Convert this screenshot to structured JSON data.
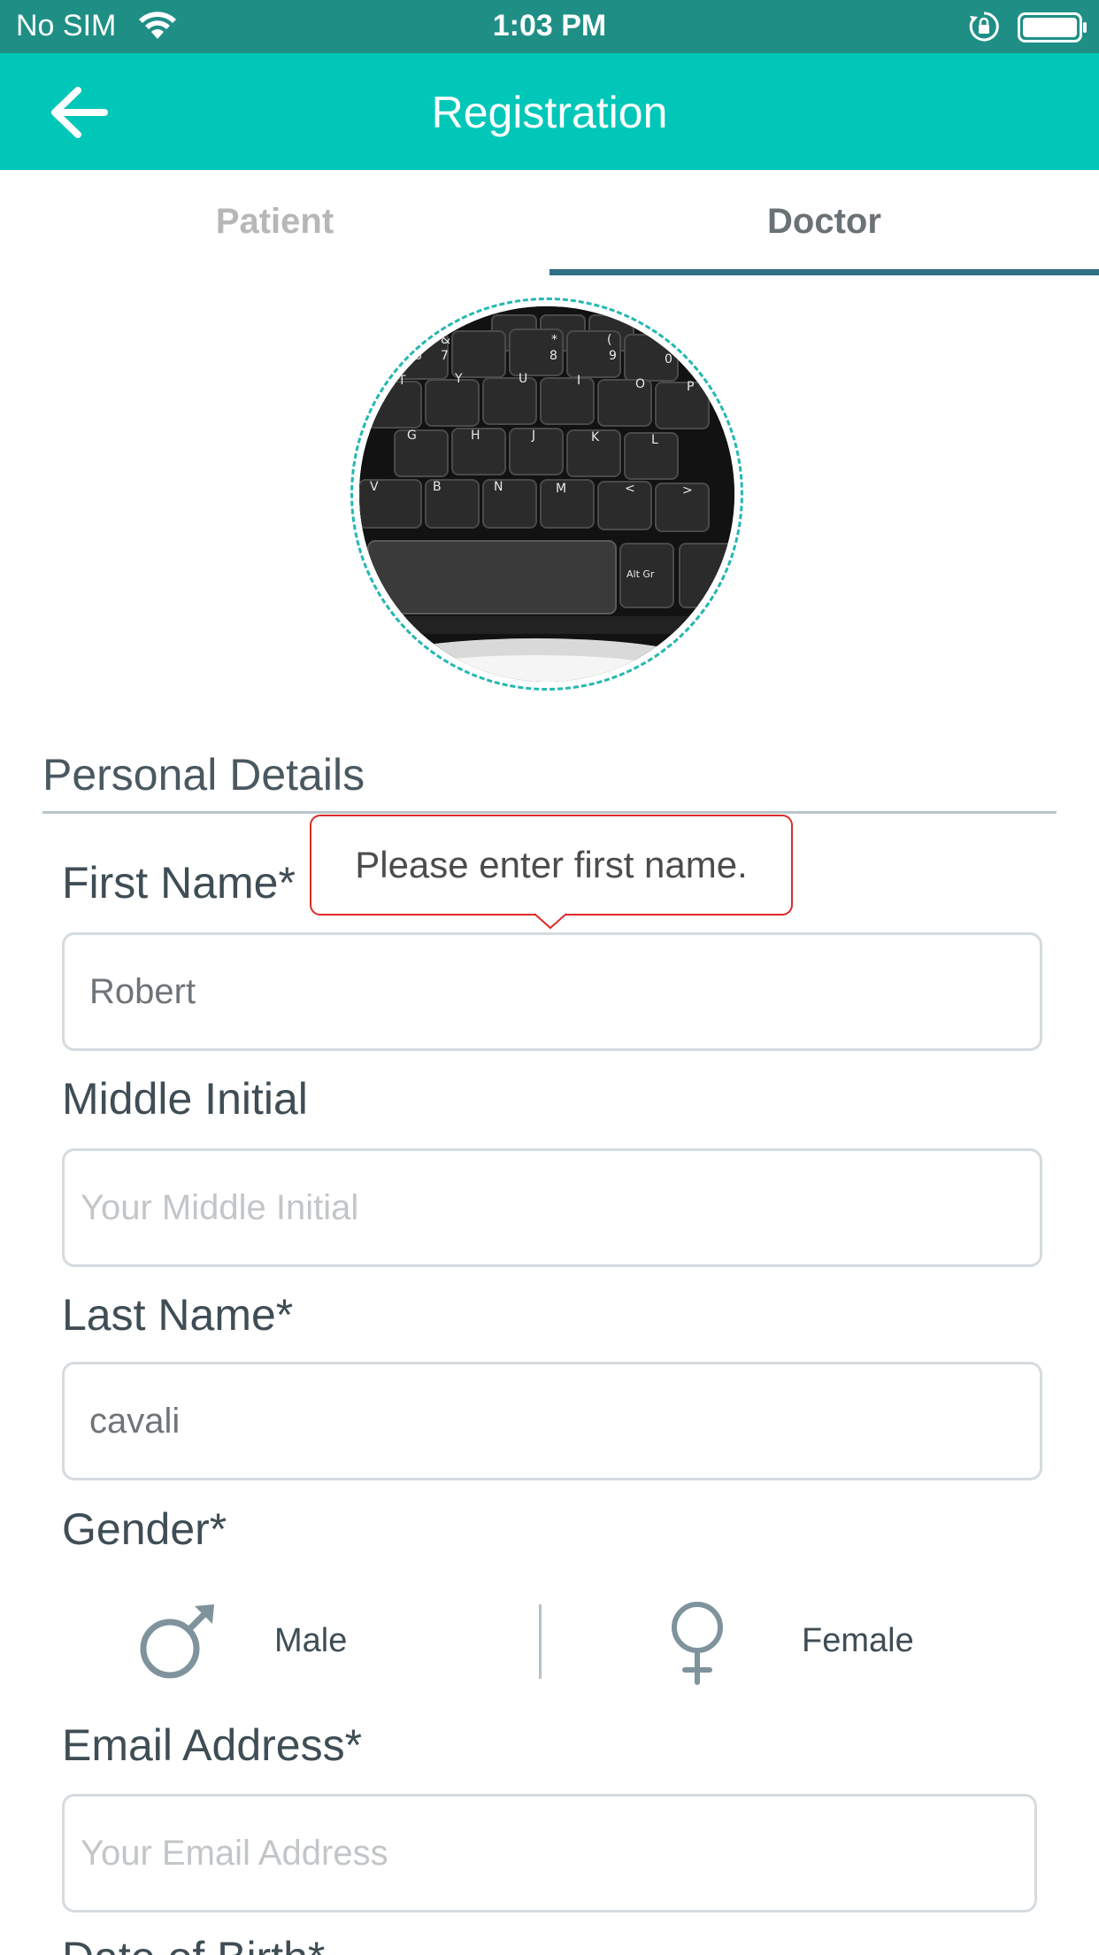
{
  "status_bar": {
    "carrier": "No SIM",
    "time": "1:03 PM"
  },
  "app_bar": {
    "title": "Registration",
    "back_icon": "arrow-left-icon"
  },
  "tabs": [
    {
      "label": "Patient",
      "selected": false
    },
    {
      "label": "Doctor",
      "selected": true
    }
  ],
  "section": {
    "title": "Personal Details"
  },
  "form": {
    "first_name": {
      "label": "First Name*",
      "value": "Robert",
      "error": "Please enter first name."
    },
    "middle_initial": {
      "label": "Middle Initial",
      "placeholder": "Your Middle Initial"
    },
    "last_name": {
      "label": "Last Name*",
      "value": "cavali"
    },
    "gender": {
      "label": "Gender*",
      "options": [
        {
          "label": "Male",
          "icon": "male-symbol-icon"
        },
        {
          "label": "Female",
          "icon": "female-symbol-icon"
        }
      ]
    },
    "email": {
      "label": "Email Address*",
      "placeholder": "Your Email Address"
    },
    "date_of_birth": {
      "label": "Date of Birth*"
    }
  },
  "colors": {
    "status_bar": "#1f8f86",
    "app_bar": "#00c7b8",
    "tab_indicator": "#2e6f86",
    "error": "#dd2a2a"
  }
}
